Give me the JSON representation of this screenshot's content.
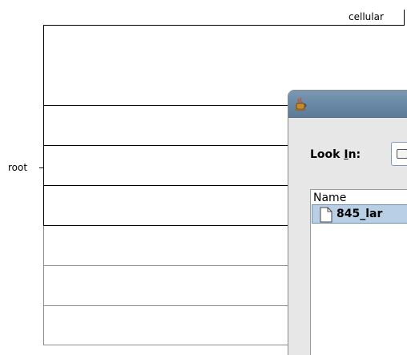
{
  "tree": {
    "root_label": "root",
    "top_label": "cellular"
  },
  "dialog": {
    "app_icon": "java-cup-icon",
    "look_in_prefix": "Look ",
    "look_in_mnemonic": "I",
    "look_in_suffix": "n:",
    "look_in_folder_icon": "folder-icon",
    "list_header": "Name",
    "files": [
      {
        "name": "845_lar",
        "icon": "file-icon"
      }
    ]
  }
}
